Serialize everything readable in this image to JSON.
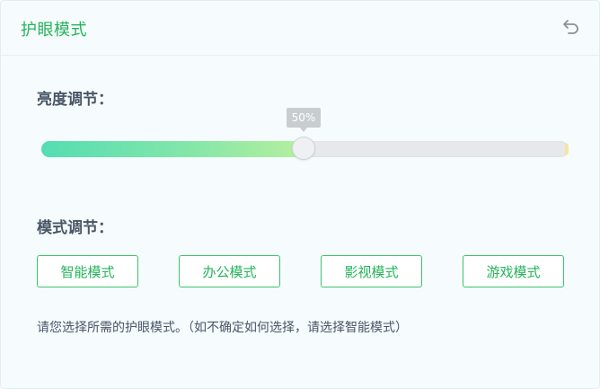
{
  "header": {
    "title": "护眼模式",
    "back_icon": "undo-arrow-icon"
  },
  "brightness": {
    "label": "亮度调节：",
    "value_percent": 50,
    "value_text": "50%"
  },
  "mode": {
    "label": "模式调节：",
    "buttons": [
      {
        "label": "智能模式"
      },
      {
        "label": "办公模式"
      },
      {
        "label": "影视模式"
      },
      {
        "label": "游戏模式"
      }
    ]
  },
  "hint": "请您选择所需的护眼模式。（如不确定如何选择，请选择智能模式）",
  "colors": {
    "accent": "#25b35a",
    "slider_start": "#55ddb2",
    "slider_end": "#b7ef9f",
    "track": "#e6e8ea"
  }
}
